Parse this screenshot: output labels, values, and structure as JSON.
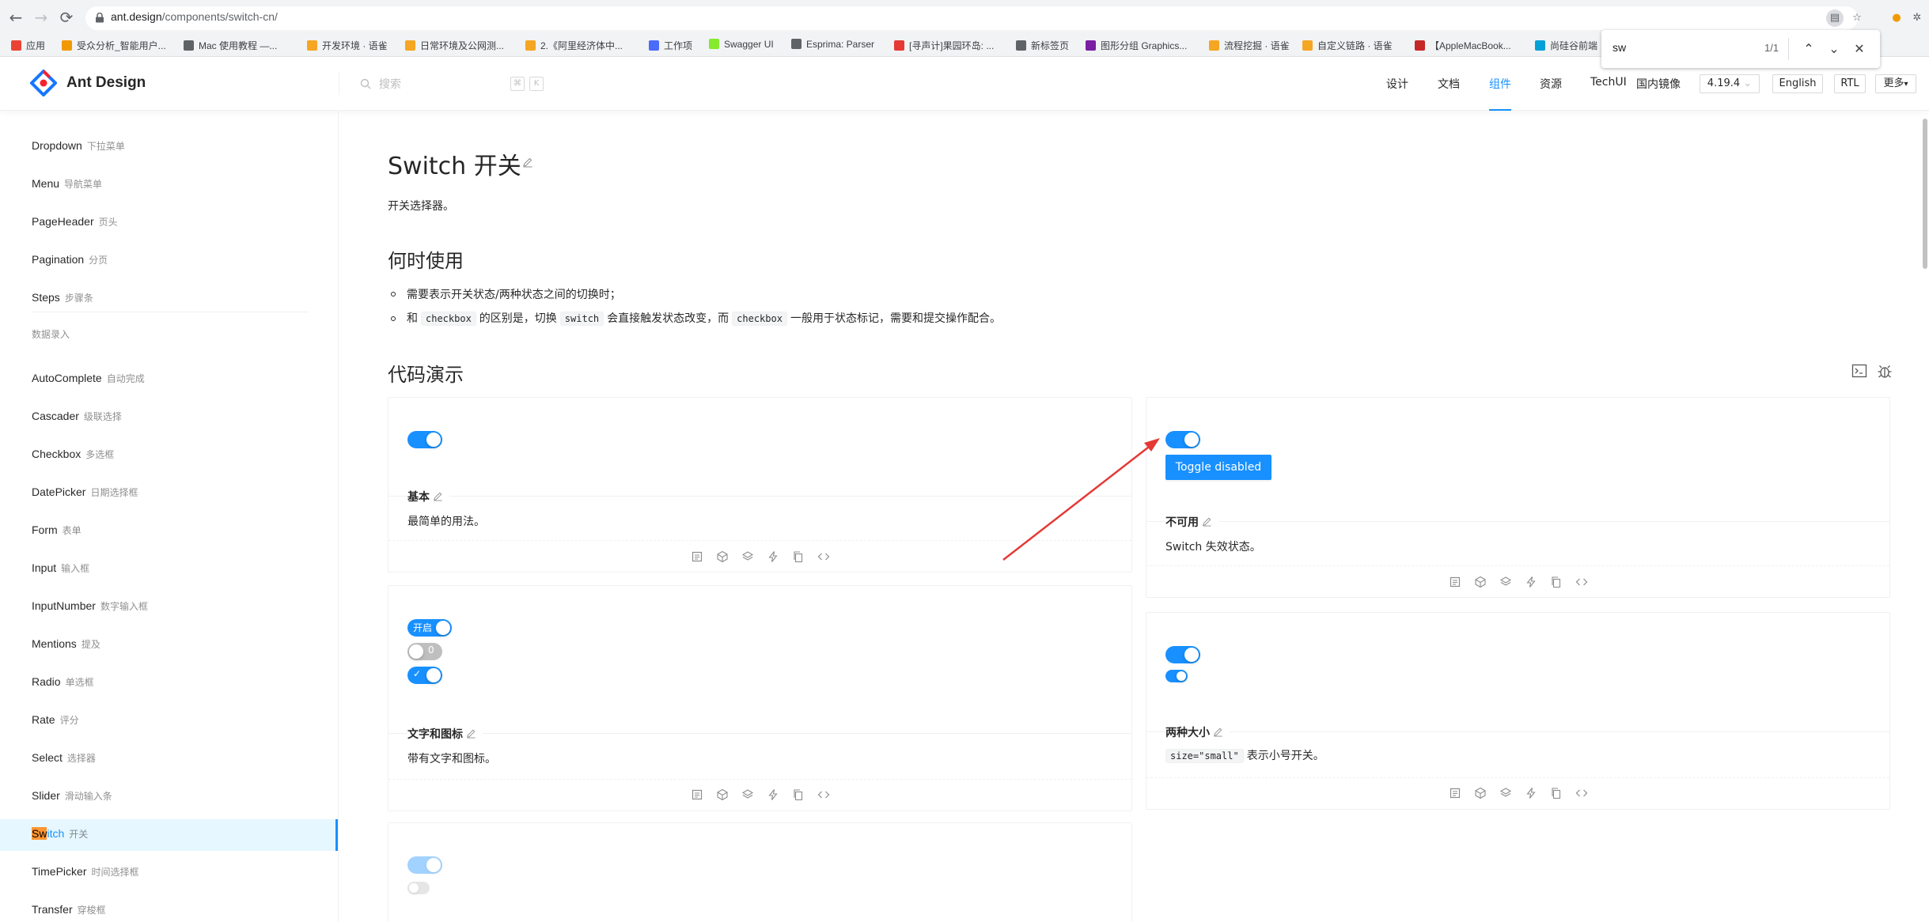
{
  "browser": {
    "url_host": "ant.design",
    "url_path": "/components/switch-cn/",
    "bookmarks": [
      {
        "label": "应用",
        "color": "#ea4335"
      },
      {
        "label": "受众分析_智能用户...",
        "color": "#f29900"
      },
      {
        "label": "Mac 使用教程 —...",
        "color": "#5f6368"
      },
      {
        "label": "开发环境 · 语雀",
        "color": "#f5a623"
      },
      {
        "label": "日常环境及公网测...",
        "color": "#f5a623"
      },
      {
        "label": "2.《阿里经济体中...",
        "color": "#f5a623"
      },
      {
        "label": "工作项",
        "color": "#4b6bfb"
      },
      {
        "label": "Swagger UI",
        "color": "#85ea2d"
      },
      {
        "label": "Esprima: Parser",
        "color": "#5f6368"
      },
      {
        "label": "[寻声计]果园环岛: ...",
        "color": "#e53935"
      },
      {
        "label": "新标签页",
        "color": "#5f6368"
      },
      {
        "label": "图形分组 Graphics...",
        "color": "#7b1fa2"
      },
      {
        "label": "流程挖掘 · 语雀",
        "color": "#f5a623"
      },
      {
        "label": "自定义链路 · 语雀",
        "color": "#f5a623"
      },
      {
        "label": "【AppleMacBook...",
        "color": "#c62828"
      },
      {
        "label": "尚硅谷前端",
        "color": "#00a1d6"
      }
    ]
  },
  "find": {
    "query": "sw",
    "count": "1/1"
  },
  "site": {
    "logo_text": "Ant Design",
    "search_placeholder": "搜索",
    "kbd_1": "⌘",
    "kbd_2": "K",
    "nav": [
      "设计",
      "文档",
      "组件",
      "资源",
      "TechUI",
      "国内镜像"
    ],
    "active_nav": "组件",
    "version": "4.19.4",
    "lang_btn": "English",
    "rtl_btn": "RTL",
    "more_btn": "更多"
  },
  "sidebar": {
    "group_label": "数据录入",
    "items_before": [
      {
        "en": "Dropdown",
        "zh": "下拉菜单"
      },
      {
        "en": "Menu",
        "zh": "导航菜单"
      },
      {
        "en": "PageHeader",
        "zh": "页头"
      },
      {
        "en": "Pagination",
        "zh": "分页"
      },
      {
        "en": "Steps",
        "zh": "步骤条"
      }
    ],
    "items_after": [
      {
        "en": "AutoComplete",
        "zh": "自动完成"
      },
      {
        "en": "Cascader",
        "zh": "级联选择"
      },
      {
        "en": "Checkbox",
        "zh": "多选框"
      },
      {
        "en": "DatePicker",
        "zh": "日期选择框"
      },
      {
        "en": "Form",
        "zh": "表单"
      },
      {
        "en": "Input",
        "zh": "输入框"
      },
      {
        "en": "InputNumber",
        "zh": "数字输入框"
      },
      {
        "en": "Mentions",
        "zh": "提及"
      },
      {
        "en": "Radio",
        "zh": "单选框"
      },
      {
        "en": "Rate",
        "zh": "评分"
      },
      {
        "en": "Select",
        "zh": "选择器"
      },
      {
        "en": "Slider",
        "zh": "滑动输入条"
      },
      {
        "en": "Switch",
        "zh": "开关",
        "active": true,
        "highlight": "Sw",
        "rest": "itch"
      },
      {
        "en": "TimePicker",
        "zh": "时间选择框"
      },
      {
        "en": "Transfer",
        "zh": "穿梭框"
      }
    ]
  },
  "content": {
    "title": "Switch 开关",
    "intro": "开关选择器。",
    "when_heading": "何时使用",
    "when_items": {
      "item1": "需要表示开关状态/两种状态之间的切换时；",
      "item2_a": "和",
      "code_checkbox": "checkbox",
      "item2_b": "的区别是，切换",
      "code_switch": "switch",
      "item2_c": "会直接触发状态改变，而",
      "item2_d": "一般用于状态标记，需要和提交操作配合。"
    },
    "demo_heading": "代码演示"
  },
  "demos": {
    "basic": {
      "title": "基本",
      "desc": "最简单的用法。"
    },
    "disabled": {
      "title": "不可用",
      "desc": "Switch 失效状态。",
      "button": "Toggle disabled"
    },
    "text_icon": {
      "title": "文字和图标",
      "desc": "带有文字和图标。",
      "on_text": "开启",
      "off_text": "0",
      "check": "✓"
    },
    "size": {
      "title": "两种大小",
      "code": "size=\"small\"",
      "desc": "表示小号开关。"
    }
  },
  "colors": {
    "primary": "#1890ff",
    "annotation_arrow": "#e53935",
    "find_highlight": "#ff9632"
  }
}
